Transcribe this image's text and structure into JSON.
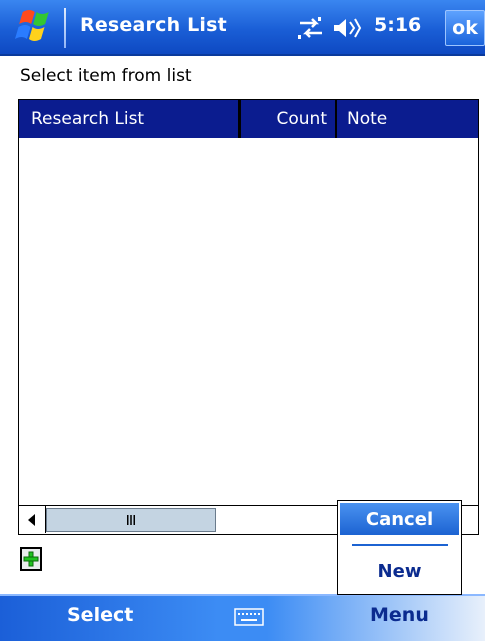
{
  "titlebar": {
    "title": "Research List",
    "time": "5:16",
    "ok_label": "ok"
  },
  "prompt": "Select item from list",
  "list": {
    "columns": [
      "Research List",
      "Count",
      "Note"
    ],
    "rows": []
  },
  "popup_menu": {
    "items": [
      "Cancel",
      "New"
    ],
    "selected": "Cancel"
  },
  "softkeys": {
    "left": "Select",
    "right": "Menu"
  },
  "icons": {
    "start": "windows-flag-icon",
    "connectivity": "connectivity-icon",
    "volume": "volume-icon",
    "add": "add-plus-icon",
    "keyboard": "keyboard-icon"
  },
  "colors": {
    "titlebar": "#1a5ed6",
    "list_header": "#0b1c8f",
    "menu_selected": "#1c63d2"
  }
}
